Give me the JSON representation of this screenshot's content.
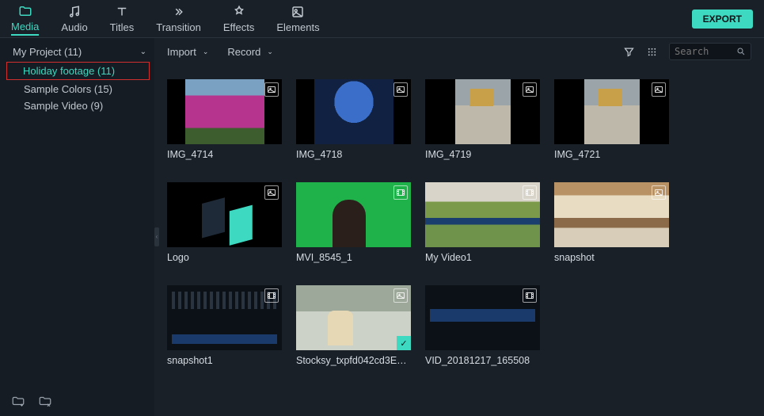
{
  "tabs": {
    "media": "Media",
    "audio": "Audio",
    "titles": "Titles",
    "transition": "Transition",
    "effects": "Effects",
    "elements": "Elements"
  },
  "export": "EXPORT",
  "sidebar": {
    "project": "My Project (11)",
    "sub_highlight": "Holiday footage (11)",
    "colors": "Sample Colors (15)",
    "video": "Sample Video (9)"
  },
  "toolbar": {
    "import": "Import",
    "record": "Record",
    "search_placeholder": "Search"
  },
  "clips": [
    {
      "label": "IMG_4714",
      "type": "image",
      "art": "art-flowers",
      "narrow": true
    },
    {
      "label": "IMG_4718",
      "type": "image",
      "art": "art-stage",
      "narrow": true
    },
    {
      "label": "IMG_4719",
      "type": "image",
      "art": "art-street",
      "narrow": true
    },
    {
      "label": "IMG_4721",
      "type": "image",
      "art": "art-street",
      "narrow": true
    },
    {
      "label": "Logo",
      "type": "image",
      "art": "art-logo",
      "narrow": false
    },
    {
      "label": "MVI_8545_1",
      "type": "video",
      "art": "art-green",
      "narrow": false
    },
    {
      "label": "My Video1",
      "type": "video",
      "art": "art-aerial",
      "narrow": false
    },
    {
      "label": "snapshot",
      "type": "image",
      "art": "art-beach",
      "narrow": false
    },
    {
      "label": "snapshot1",
      "type": "video",
      "art": "art-snap2",
      "narrow": false
    },
    {
      "label": "Stocksy_txpfd042cd3EA...",
      "type": "image",
      "art": "art-stock",
      "narrow": false,
      "checked": true
    },
    {
      "label": "VID_20181217_165508",
      "type": "video",
      "art": "art-vid",
      "narrow": false
    }
  ]
}
